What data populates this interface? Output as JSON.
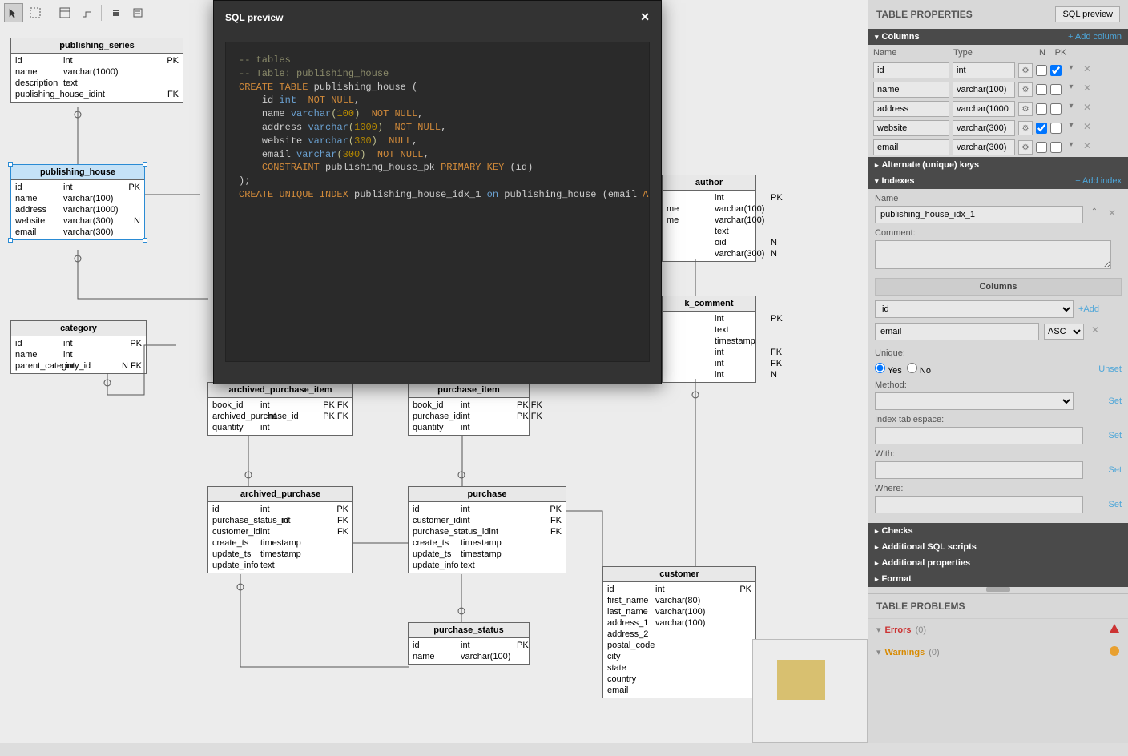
{
  "toolbar": {
    "tools": [
      "selection",
      "marquee",
      "shape",
      "line",
      "step",
      "table",
      "list"
    ]
  },
  "modal": {
    "title": "SQL preview",
    "sql": {
      "c1": "-- tables",
      "c2": "-- Table: publishing_house",
      "l1a": "CREATE TABLE",
      "l1b": "publishing_house (",
      "l2a": "id",
      "l2b": "int",
      "l2c": "NOT NULL",
      "l2d": ",",
      "l3a": "name",
      "l3b": "varchar",
      "l3c": "(",
      "l3d": "100",
      "l3e": ")",
      "l3f": "NOT NULL",
      "l3g": ",",
      "l4a": "address",
      "l4b": "varchar",
      "l4c": "(",
      "l4d": "1000",
      "l4e": ")",
      "l4f": "NOT NULL",
      "l4g": ",",
      "l5a": "website",
      "l5b": "varchar",
      "l5c": "(",
      "l5d": "300",
      "l5e": ")",
      "l5f": "NULL",
      "l5g": ",",
      "l6a": "email",
      "l6b": "varchar",
      "l6c": "(",
      "l6d": "300",
      "l6e": ")",
      "l6f": "NOT NULL",
      "l6g": ",",
      "l7a": "CONSTRAINT",
      "l7b": "publishing_house_pk",
      "l7c": "PRIMARY KEY",
      "l7d": "(id)",
      "l8": ");",
      "l9a": "CREATE UNIQUE INDEX",
      "l9b": "publishing_house_idx_1",
      "l9c": "on",
      "l9d": "publishing_house (email",
      "l9e": "ASC",
      "l9f": ");"
    }
  },
  "tables": {
    "publishing_series": {
      "name": "publishing_series",
      "cols": [
        {
          "n": "id",
          "t": "int",
          "k": "PK"
        },
        {
          "n": "name",
          "t": "varchar(1000)",
          "k": ""
        },
        {
          "n": "description",
          "t": "text",
          "k": ""
        },
        {
          "n": "publishing_house_id",
          "t": "int",
          "k": "FK"
        }
      ]
    },
    "publishing_house": {
      "name": "publishing_house",
      "cols": [
        {
          "n": "id",
          "t": "int",
          "k": "PK"
        },
        {
          "n": "name",
          "t": "varchar(100)",
          "k": ""
        },
        {
          "n": "address",
          "t": "varchar(1000)",
          "k": ""
        },
        {
          "n": "website",
          "t": "varchar(300)",
          "k": "N"
        },
        {
          "n": "email",
          "t": "varchar(300)",
          "k": ""
        }
      ]
    },
    "category": {
      "name": "category",
      "cols": [
        {
          "n": "id",
          "t": "int",
          "k": "PK"
        },
        {
          "n": "name",
          "t": "int",
          "k": ""
        },
        {
          "n": "parent_category_id",
          "t": "int",
          "k": "N FK"
        }
      ]
    },
    "archived_purchase_item": {
      "name": "archived_purchase_item",
      "cols": [
        {
          "n": "book_id",
          "t": "int",
          "k": "PK FK"
        },
        {
          "n": "archived_purchase_id",
          "t": "int",
          "k": "PK FK"
        },
        {
          "n": "quantity",
          "t": "int",
          "k": ""
        }
      ]
    },
    "purchase_item": {
      "name": "purchase_item",
      "cols": [
        {
          "n": "book_id",
          "t": "int",
          "k": "PK FK"
        },
        {
          "n": "purchase_id",
          "t": "int",
          "k": "PK FK"
        },
        {
          "n": "quantity",
          "t": "int",
          "k": ""
        }
      ]
    },
    "archived_purchase": {
      "name": "archived_purchase",
      "cols": [
        {
          "n": "id",
          "t": "int",
          "k": "PK"
        },
        {
          "n": "purchase_status_id",
          "t": "int",
          "k": "FK"
        },
        {
          "n": "customer_id",
          "t": "int",
          "k": "FK"
        },
        {
          "n": "create_ts",
          "t": "timestamp",
          "k": ""
        },
        {
          "n": "update_ts",
          "t": "timestamp",
          "k": ""
        },
        {
          "n": "update_info",
          "t": "text",
          "k": ""
        }
      ]
    },
    "purchase": {
      "name": "purchase",
      "cols": [
        {
          "n": "id",
          "t": "int",
          "k": "PK"
        },
        {
          "n": "customer_id",
          "t": "int",
          "k": "FK"
        },
        {
          "n": "purchase_status_id",
          "t": "int",
          "k": "FK"
        },
        {
          "n": "create_ts",
          "t": "timestamp",
          "k": ""
        },
        {
          "n": "update_ts",
          "t": "timestamp",
          "k": ""
        },
        {
          "n": "update_info",
          "t": "text",
          "k": ""
        }
      ]
    },
    "purchase_status": {
      "name": "purchase_status",
      "cols": [
        {
          "n": "id",
          "t": "int",
          "k": "PK"
        },
        {
          "n": "name",
          "t": "varchar(100)",
          "k": ""
        }
      ]
    },
    "author": {
      "name": "author",
      "cols": [
        {
          "n": "",
          "t": "int",
          "k": "PK"
        },
        {
          "n": "me",
          "t": "varchar(100)",
          "k": ""
        },
        {
          "n": "me",
          "t": "varchar(100)",
          "k": ""
        },
        {
          "n": "",
          "t": "text",
          "k": ""
        },
        {
          "n": "",
          "t": "oid",
          "k": "N"
        },
        {
          "n": "",
          "t": "varchar(300)",
          "k": "N"
        }
      ]
    },
    "k_comment": {
      "name": "k_comment",
      "cols": [
        {
          "n": "",
          "t": "int",
          "k": "PK"
        },
        {
          "n": "",
          "t": "text",
          "k": ""
        },
        {
          "n": "",
          "t": "timestamp",
          "k": ""
        },
        {
          "n": "",
          "t": "int",
          "k": "FK"
        },
        {
          "n": "",
          "t": "int",
          "k": "FK"
        },
        {
          "n": "",
          "t": "int",
          "k": "N"
        }
      ]
    },
    "customer": {
      "name": "customer",
      "cols": [
        {
          "n": "id",
          "t": "int",
          "k": "PK"
        },
        {
          "n": "first_name",
          "t": "varchar(80)",
          "k": ""
        },
        {
          "n": "last_name",
          "t": "varchar(100)",
          "k": ""
        },
        {
          "n": "address_1",
          "t": "varchar(100)",
          "k": ""
        },
        {
          "n": "address_2",
          "t": "",
          "k": ""
        },
        {
          "n": "postal_code",
          "t": "",
          "k": ""
        },
        {
          "n": "city",
          "t": "",
          "k": ""
        },
        {
          "n": "state",
          "t": "",
          "k": ""
        },
        {
          "n": "country",
          "t": "",
          "k": ""
        },
        {
          "n": "email",
          "t": "",
          "k": ""
        }
      ]
    }
  },
  "props": {
    "title": "TABLE PROPERTIES",
    "sqlBtn": "SQL preview",
    "sections": {
      "columns": "Columns",
      "addCol": "+ Add column",
      "altKeys": "Alternate (unique) keys",
      "indexes": "Indexes",
      "addIdx": "+ Add index",
      "checks": "Checks",
      "addl": "Additional SQL scripts",
      "addlProps": "Additional properties",
      "format": "Format"
    },
    "colHdr": {
      "name": "Name",
      "type": "Type",
      "n": "N",
      "pk": "PK"
    },
    "cols": [
      {
        "name": "id",
        "type": "int",
        "n": false,
        "pk": true
      },
      {
        "name": "name",
        "type": "varchar(100)",
        "n": false,
        "pk": false
      },
      {
        "name": "address",
        "type": "varchar(1000",
        "n": false,
        "pk": false
      },
      {
        "name": "website",
        "type": "varchar(300)",
        "n": true,
        "pk": false
      },
      {
        "name": "email",
        "type": "varchar(300)",
        "n": false,
        "pk": false
      }
    ],
    "idx": {
      "nameLabel": "Name",
      "nameVal": "publishing_house_idx_1",
      "commentLabel": "Comment:",
      "colsHdr": "Columns",
      "colSel": "id",
      "addLink": "+Add",
      "colRow": "email",
      "sort": "ASC",
      "uniqueLabel": "Unique:",
      "yes": "Yes",
      "no": "No",
      "unset": "Unset",
      "methodLabel": "Method:",
      "tablespaceLabel": "Index tablespace:",
      "withLabel": "With:",
      "whereLabel": "Where:",
      "setLink": "Set"
    }
  },
  "problems": {
    "title": "TABLE PROBLEMS",
    "errors": "Errors",
    "errCount": "(0)",
    "warnings": "Warnings",
    "warnCount": "(0)"
  }
}
